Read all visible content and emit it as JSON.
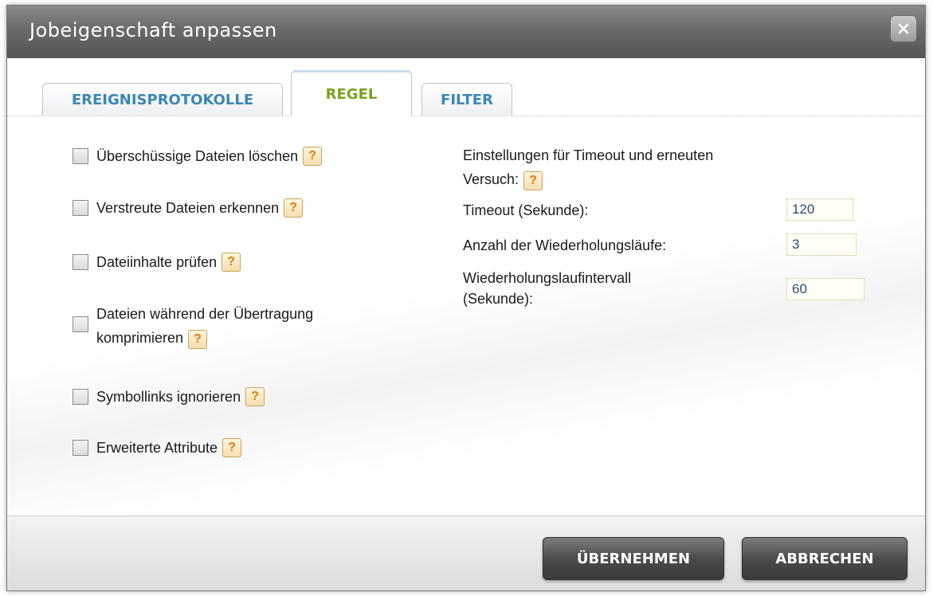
{
  "dialog": {
    "title": "Jobeigenschaft anpassen",
    "close_icon": "close-icon"
  },
  "tabs": [
    {
      "label": "EREIGNISPROTOKOLLE",
      "active": false
    },
    {
      "label": "REGEL",
      "active": true
    },
    {
      "label": "FILTER",
      "active": false
    }
  ],
  "options": {
    "surplus": {
      "label": "Überschüssige Dateien löschen",
      "checked": false
    },
    "sparse": {
      "label": "Verstreute Dateien erkennen",
      "checked": false
    },
    "verify": {
      "label": "Dateiinhalte prüfen",
      "checked": false
    },
    "compress_line1": "Dateien während der Übertragung",
    "compress_line2": "komprimieren",
    "compress_checked": false,
    "symlinks": {
      "label": "Symbollinks ignorieren",
      "checked": false
    },
    "attributes": {
      "label": "Erweiterte Attribute",
      "checked": false
    }
  },
  "help_glyph": "?",
  "retry": {
    "heading_line1": "Einstellungen für Timeout und erneuten",
    "heading_line2": "Versuch:",
    "timeout_label": "Timeout (Sekunde):",
    "timeout_value": "120",
    "retries_label": "Anzahl der Wiederholungsläufe:",
    "retries_value": "3",
    "interval_label_line1": "Wiederholungslaufintervall",
    "interval_label_line2": "(Sekunde):",
    "interval_value": "60"
  },
  "footer": {
    "apply_label": "ÜBERNEHMEN",
    "cancel_label": "ABBRECHEN"
  },
  "colors": {
    "tab_active": "#7aa21e",
    "tab_inactive": "#3a87b6",
    "help_icon": "#e07a10"
  }
}
